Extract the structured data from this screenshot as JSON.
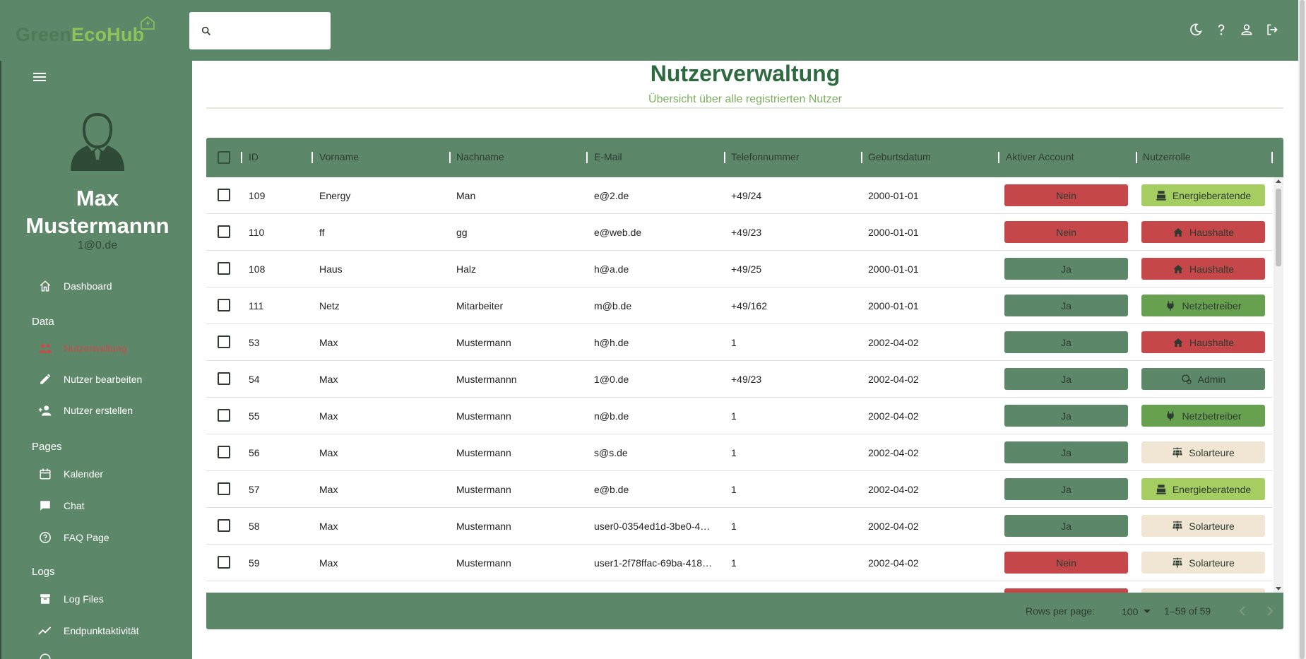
{
  "app": {
    "logo_green": "Green",
    "logo_eco": "Eco",
    "logo_hub": "Hub"
  },
  "search": {
    "placeholder": ""
  },
  "topbar_icons": [
    "moon-icon",
    "help-icon",
    "person-icon",
    "logout-icon"
  ],
  "sidebar": {
    "user_name": "Max Mustermannn",
    "user_email": "1@0.de",
    "sections": {
      "data": "Data",
      "pages": "Pages",
      "logs": "Logs"
    },
    "items": {
      "dashboard": "Dashboard",
      "nutzerwaltung": "Nutzerwaltung",
      "nutzer_bearbeiten": "Nutzer bearbeiten",
      "nutzer_erstellen": "Nutzer erstellen",
      "kalender": "Kalender",
      "chat": "Chat",
      "faq": "FAQ Page",
      "log_files": "Log Files",
      "endpunkt": "Endpunktaktivität"
    }
  },
  "page": {
    "title": "Nutzerverwaltung",
    "subtitle": "Übersicht über alle registrierten Nutzer"
  },
  "table": {
    "columns": [
      "ID",
      "Vorname",
      "Nachname",
      "E-Mail",
      "Telefonnummer",
      "Geburtsdatum",
      "Aktiver Account",
      "Nutzerrolle"
    ],
    "rows": [
      {
        "id": "109",
        "vorname": "Energy",
        "nachname": "Man",
        "email": "e@2.de",
        "telefon": "+49/24",
        "geburt": "2000-01-01",
        "aktiv": "Nein",
        "rolle": "Energieberatende"
      },
      {
        "id": "110",
        "vorname": "ff",
        "nachname": "gg",
        "email": "e@web.de",
        "telefon": "+49/23",
        "geburt": "2000-01-01",
        "aktiv": "Nein",
        "rolle": "Haushalte"
      },
      {
        "id": "108",
        "vorname": "Haus",
        "nachname": "Halz",
        "email": "h@a.de",
        "telefon": "+49/25",
        "geburt": "2000-01-01",
        "aktiv": "Ja",
        "rolle": "Haushalte"
      },
      {
        "id": "111",
        "vorname": "Netz",
        "nachname": "Mitarbeiter",
        "email": "m@b.de",
        "telefon": "+49/162",
        "geburt": "2000-01-01",
        "aktiv": "Ja",
        "rolle": "Netzbetreiber"
      },
      {
        "id": "53",
        "vorname": "Max",
        "nachname": "Mustermann",
        "email": "h@h.de",
        "telefon": "1",
        "geburt": "2002-04-02",
        "aktiv": "Ja",
        "rolle": "Haushalte"
      },
      {
        "id": "54",
        "vorname": "Max",
        "nachname": "Mustermannn",
        "email": "1@0.de",
        "telefon": "+49/23",
        "geburt": "2002-04-02",
        "aktiv": "Ja",
        "rolle": "Admin"
      },
      {
        "id": "55",
        "vorname": "Max",
        "nachname": "Mustermann",
        "email": "n@b.de",
        "telefon": "1",
        "geburt": "2002-04-02",
        "aktiv": "Ja",
        "rolle": "Netzbetreiber"
      },
      {
        "id": "56",
        "vorname": "Max",
        "nachname": "Mustermann",
        "email": "s@s.de",
        "telefon": "1",
        "geburt": "2002-04-02",
        "aktiv": "Ja",
        "rolle": "Solarteure"
      },
      {
        "id": "57",
        "vorname": "Max",
        "nachname": "Mustermann",
        "email": "e@b.de",
        "telefon": "1",
        "geburt": "2002-04-02",
        "aktiv": "Ja",
        "rolle": "Energieberatende"
      },
      {
        "id": "58",
        "vorname": "Max",
        "nachname": "Mustermann",
        "email": "user0-0354ed1d-3be0-4…",
        "telefon": "1",
        "geburt": "2002-04-02",
        "aktiv": "Ja",
        "rolle": "Solarteure"
      },
      {
        "id": "59",
        "vorname": "Max",
        "nachname": "Mustermann",
        "email": "user1-2f78ffac-69ba-418…",
        "telefon": "1",
        "geburt": "2002-04-02",
        "aktiv": "Nein",
        "rolle": "Solarteure"
      }
    ]
  },
  "footer": {
    "rows_per_page_label": "Rows per page:",
    "rows_per_page_value": "100",
    "range": "1–59 of 59"
  },
  "colors": {
    "brand": "#5d8769",
    "nein": "#c5474a",
    "energie": "#a6cd62",
    "netz": "#67a14f",
    "solar": "#f0e6d3"
  }
}
